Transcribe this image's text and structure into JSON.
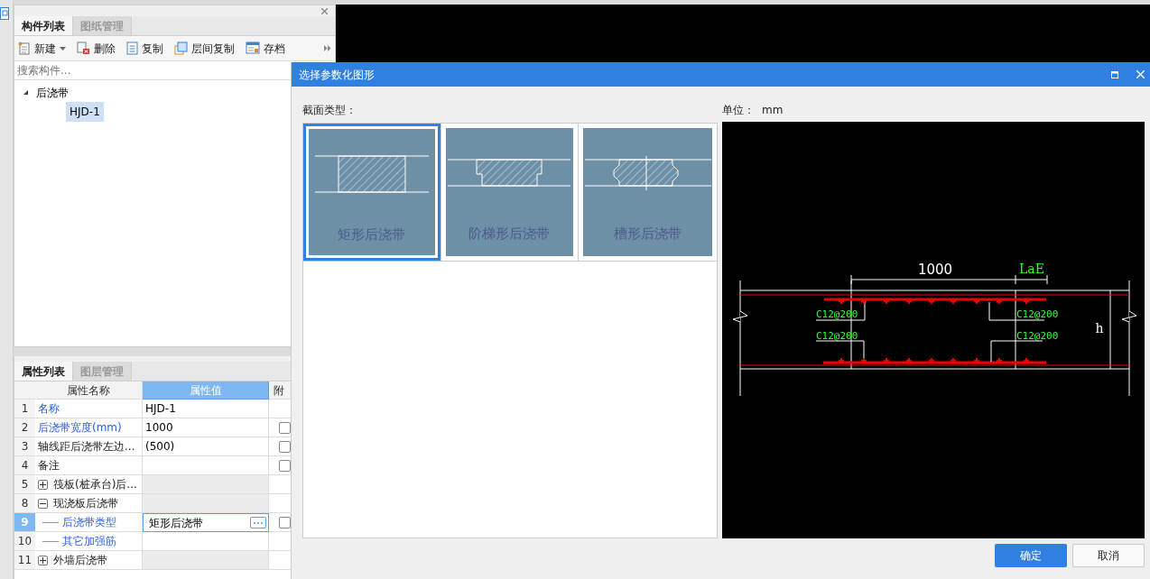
{
  "component_panel": {
    "tabs": [
      {
        "label": "构件列表",
        "selected": true
      },
      {
        "label": "图纸管理",
        "selected": false
      }
    ],
    "toolbar": [
      {
        "kind": "new",
        "label": "新建",
        "dropdown": true
      },
      {
        "kind": "delete",
        "label": "删除",
        "dropdown": false
      },
      {
        "kind": "copy",
        "label": "复制",
        "dropdown": false
      },
      {
        "kind": "floor_copy",
        "label": "层间复制",
        "dropdown": false
      },
      {
        "kind": "archive",
        "label": "存档",
        "dropdown": false
      }
    ],
    "search": {
      "placeholder": "搜索构件..."
    },
    "tree": [
      {
        "label": "后浇带",
        "expanded": true,
        "selected": false,
        "children": [
          {
            "label": "HJD-1",
            "selected": true
          }
        ]
      }
    ]
  },
  "property_panel": {
    "tabs": [
      {
        "label": "属性列表",
        "selected": true
      },
      {
        "label": "图层管理",
        "selected": false
      }
    ],
    "columns": [
      "属性名称",
      "属性值",
      "附"
    ],
    "rows": [
      {
        "kind": "field",
        "num": "1",
        "name": "名称",
        "value": "HJD-1",
        "public": true,
        "selected": false
      },
      {
        "kind": "field",
        "num": "2",
        "name": "后浇带宽度(mm)",
        "value": "1000",
        "public": true,
        "checked": false,
        "selected": false
      },
      {
        "kind": "field",
        "num": "3",
        "name": "轴线距后浇带左边...",
        "value": "(500)",
        "public": false,
        "checked": false,
        "selected": false
      },
      {
        "kind": "field",
        "num": "4",
        "name": "备注",
        "value": "",
        "public": false,
        "checked": false,
        "selected": false
      },
      {
        "kind": "group",
        "num": "5",
        "name": "筏板(桩承台)后...",
        "expanded": false,
        "selected": false
      },
      {
        "kind": "group",
        "num": "8",
        "name": "现浇板后浇带",
        "expanded": true,
        "selected": false
      },
      {
        "kind": "child",
        "num": "9",
        "name": "后浇带类型",
        "value": "矩形后浇带",
        "public": true,
        "checked": false,
        "selected": true
      },
      {
        "kind": "child",
        "num": "10",
        "name": "其它加强筋",
        "value": "",
        "public": true,
        "selected": false
      },
      {
        "kind": "group",
        "num": "11",
        "name": "外墙后浇带",
        "expanded": false,
        "selected": false
      }
    ]
  },
  "dialog": {
    "title": "选择参数化图形",
    "section_label": "截面类型：",
    "unit_label": "单位：",
    "unit": "mm",
    "shapes": [
      {
        "kind": "rect",
        "label": "矩形后浇带",
        "selected": true
      },
      {
        "kind": "step",
        "label": "阶梯形后浇带",
        "selected": false
      },
      {
        "kind": "groove",
        "label": "槽形后浇带",
        "selected": false
      }
    ],
    "preview": {
      "width_dim": "1000",
      "anchor_dim": "LaE",
      "height_dim": "h",
      "rebar_labels": [
        "C12@200",
        "C12@200",
        "C12@200",
        "C12@200"
      ]
    },
    "buttons": [
      {
        "kind": "primary",
        "label": "确定"
      },
      {
        "kind": "secondary",
        "label": "取消"
      }
    ]
  }
}
